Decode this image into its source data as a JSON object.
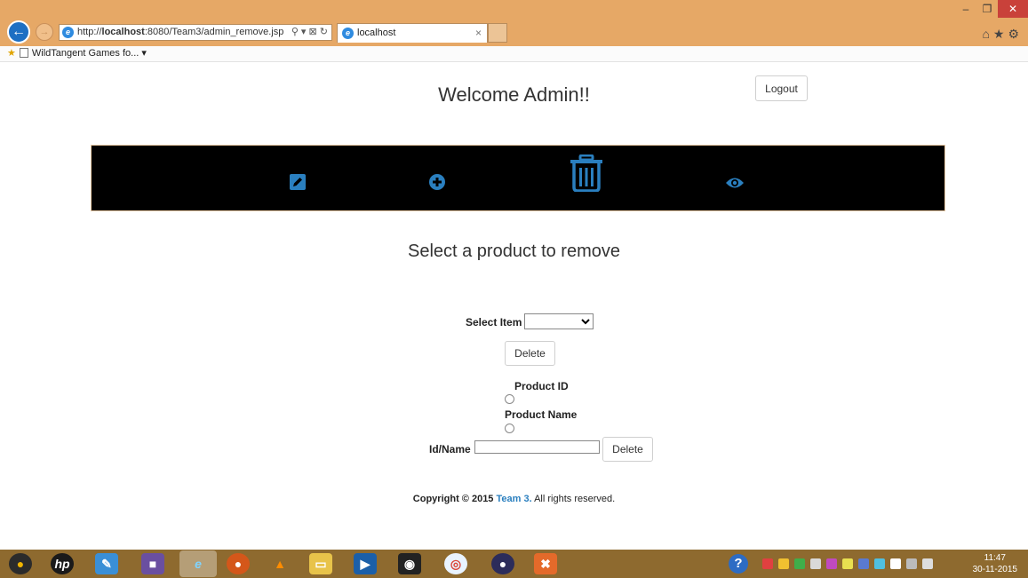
{
  "browser": {
    "url_prefix": "http://",
    "url_host": "localhost",
    "url_rest": ":8080/Team3/admin_remove.jsp",
    "url_tools": "⚲ ▾ ⊠ ↻",
    "tab_title": "localhost",
    "favorites_item": "WildTangent Games fo...",
    "back_glyph": "←",
    "forward_glyph": "→",
    "tab_close_glyph": "×",
    "minimize_glyph": "–",
    "restore_glyph": "❐",
    "close_glyph": "✕",
    "right_icons": "⌂★⚙"
  },
  "header": {
    "welcome": "Welcome Admin!!",
    "logout_label": "Logout"
  },
  "nav": {
    "icons": [
      "edit-icon",
      "add-icon",
      "trash-icon",
      "view-icon"
    ],
    "icon_color": "#2a7fbf"
  },
  "form": {
    "title": "Select a product to remove",
    "select_label": "Select Item",
    "select_value": "",
    "delete_label": "Delete",
    "product_id_label": "Product ID",
    "product_name_label": "Product Name",
    "idname_label": "Id/Name",
    "idname_value": "",
    "delete2_label": "Delete"
  },
  "footer": {
    "prefix": "Copyright © 2015 ",
    "team": "Team 3.",
    "suffix": " All rights reserved."
  },
  "taskbar": {
    "help_glyph": "?",
    "time": "11:47",
    "date": "30-11-2015"
  }
}
